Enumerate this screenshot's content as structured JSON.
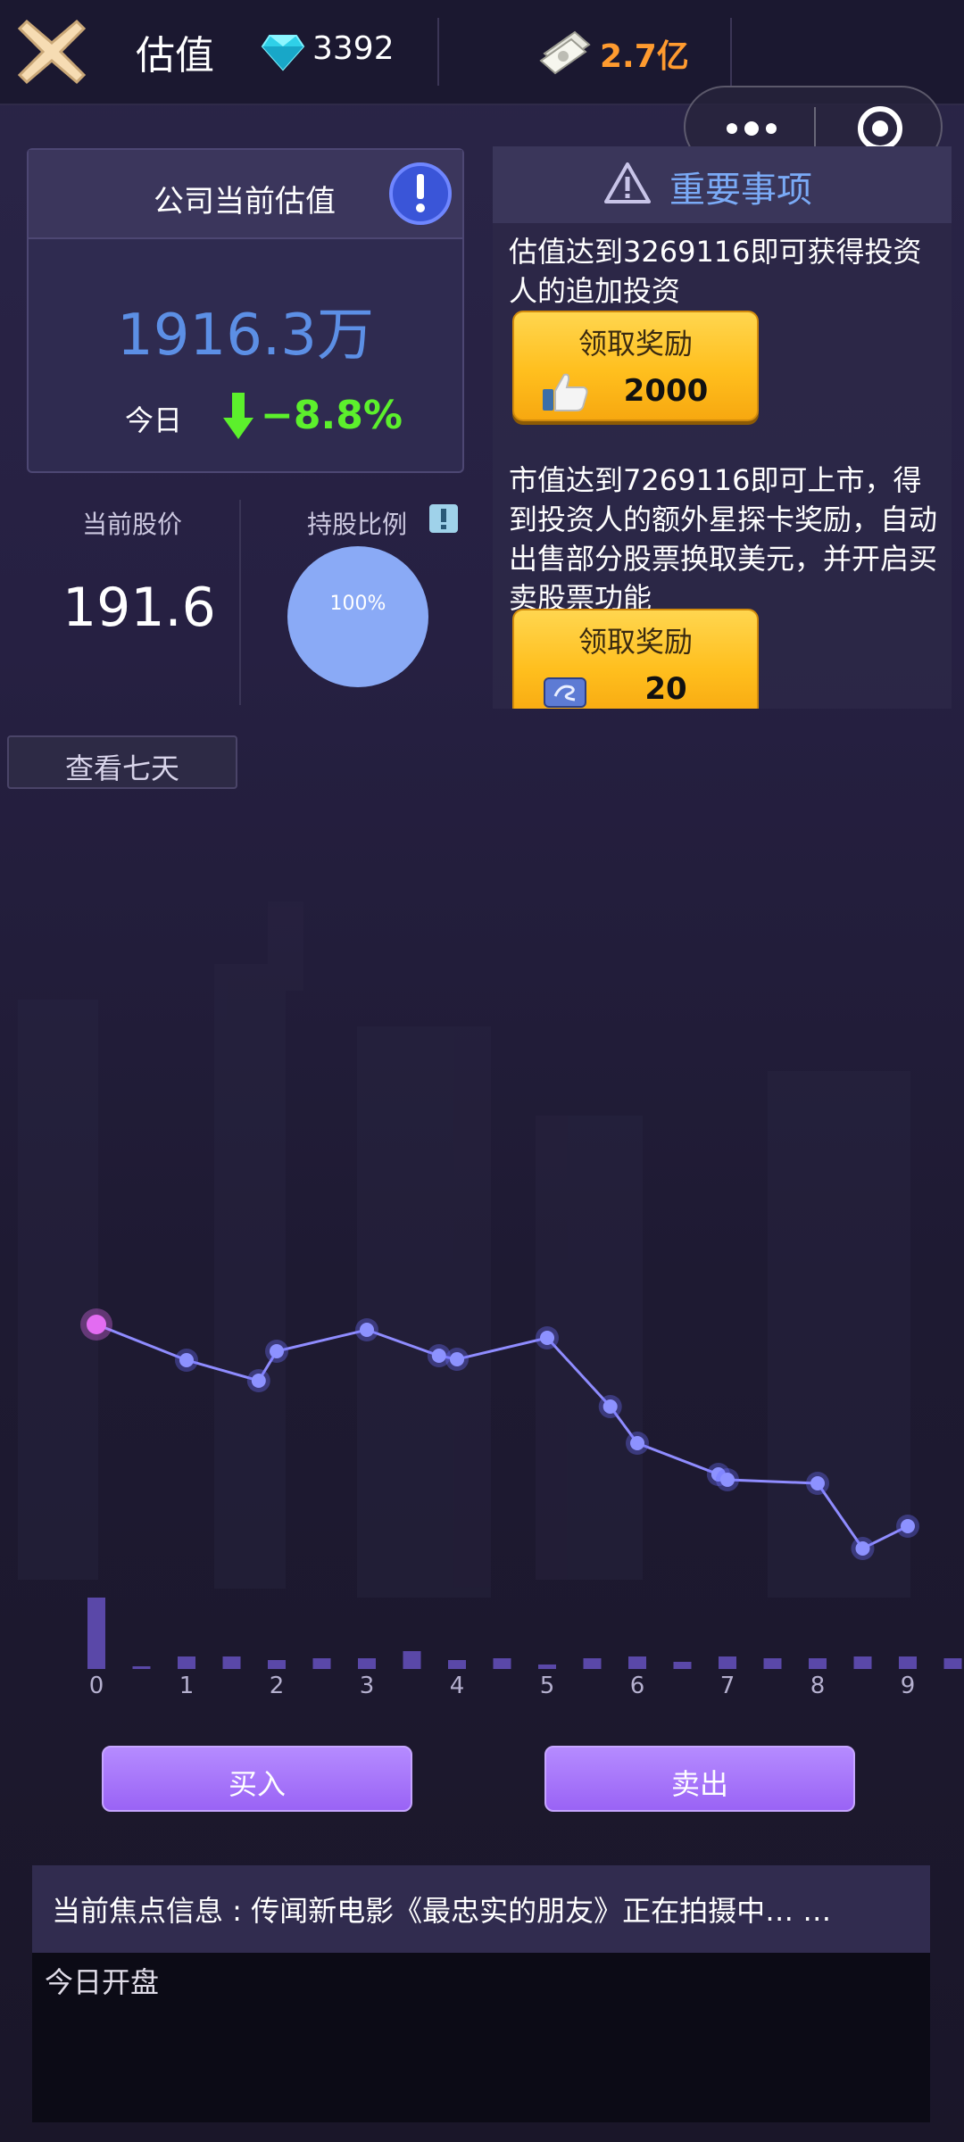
{
  "header": {
    "title": "估值",
    "gems": "3392",
    "money": "2.7亿"
  },
  "valuation": {
    "title": "公司当前估值",
    "amount": "1916.3万",
    "today_label": "今日",
    "change": "−8.8%"
  },
  "stock": {
    "price_label": "当前股价",
    "price": "191.6",
    "holding_label": "持股比例",
    "holding_pct": "100%",
    "holding_fraction": 1.0
  },
  "important": {
    "title": "重要事项",
    "item1_text": "估值达到3269116即可获得投资人的追加投资",
    "item1_button": "领取奖励",
    "item1_reward": "2000",
    "item2_text": "市值达到7269116即可上市，得到投资人的额外星探卡奖励，自动出售部分股票换取美元，并开启买卖股票功能",
    "item2_button": "领取奖励",
    "item2_reward": "20"
  },
  "view_week": "查看七天",
  "chart_data": {
    "type": "line",
    "x_ticks": [
      "0",
      "1",
      "2",
      "3",
      "4",
      "5",
      "6",
      "7",
      "8",
      "9"
    ],
    "line": [
      {
        "x": 0.0,
        "y": 251
      },
      {
        "x": 1.0,
        "y": 211
      },
      {
        "x": 1.8,
        "y": 188
      },
      {
        "x": 2.0,
        "y": 221
      },
      {
        "x": 3.0,
        "y": 245
      },
      {
        "x": 3.8,
        "y": 216
      },
      {
        "x": 4.0,
        "y": 212
      },
      {
        "x": 5.0,
        "y": 236
      },
      {
        "x": 5.7,
        "y": 159
      },
      {
        "x": 6.0,
        "y": 118
      },
      {
        "x": 6.9,
        "y": 83
      },
      {
        "x": 7.0,
        "y": 77
      },
      {
        "x": 8.0,
        "y": 73
      },
      {
        "x": 8.5,
        "y": 0
      },
      {
        "x": 9.0,
        "y": 25
      }
    ],
    "volume": [
      {
        "x": 0.0,
        "v": 80
      },
      {
        "x": 0.5,
        "v": 3
      },
      {
        "x": 1.0,
        "v": 14
      },
      {
        "x": 1.5,
        "v": 14
      },
      {
        "x": 2.0,
        "v": 10
      },
      {
        "x": 2.5,
        "v": 12
      },
      {
        "x": 3.0,
        "v": 12
      },
      {
        "x": 3.5,
        "v": 20
      },
      {
        "x": 4.0,
        "v": 10
      },
      {
        "x": 4.5,
        "v": 12
      },
      {
        "x": 5.0,
        "v": 5
      },
      {
        "x": 5.5,
        "v": 12
      },
      {
        "x": 6.0,
        "v": 14
      },
      {
        "x": 6.5,
        "v": 8
      },
      {
        "x": 7.0,
        "v": 14
      },
      {
        "x": 7.5,
        "v": 12
      },
      {
        "x": 8.0,
        "v": 12
      },
      {
        "x": 8.5,
        "v": 14
      },
      {
        "x": 9.0,
        "v": 14
      },
      {
        "x": 9.5,
        "v": 12
      }
    ],
    "line_color": "#8f8cff",
    "first_point_color": "#e36cf2",
    "volume_color": "#5a48a8",
    "grid": false
  },
  "actions": {
    "buy": "买入",
    "sell": "卖出"
  },
  "focus": {
    "text": "当前焦点信息 : 传闻新电影《最忠实的朋友》正在拍摄中… …"
  },
  "log": {
    "line1": "今日开盘"
  }
}
